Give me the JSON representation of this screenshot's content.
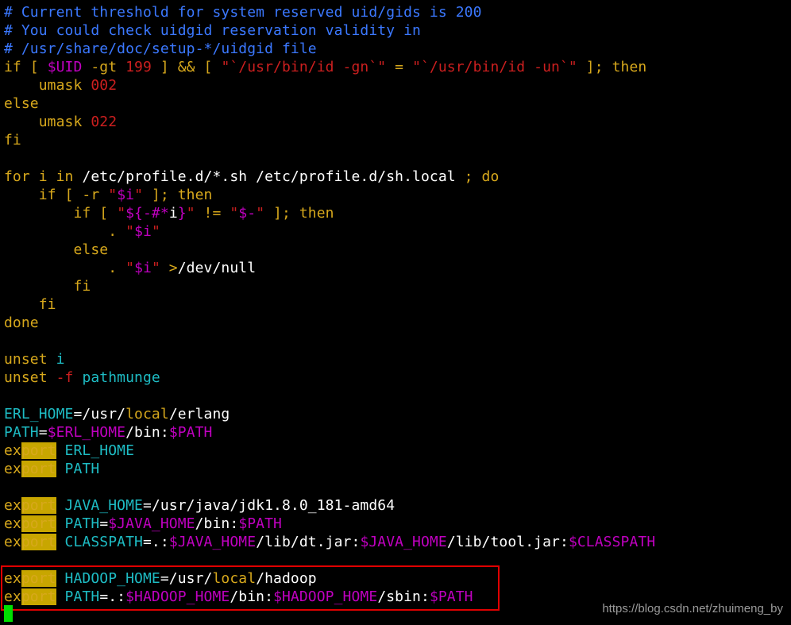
{
  "colors": {
    "comment": "#3b78ff",
    "keyword": "#d7a81c",
    "string": "#cc1f1f",
    "variable": "#c000c0",
    "identifier": "#1ebcc4",
    "plain": "#ffffff",
    "search_highlight": "#c8a600",
    "annotation_box": "#e00000",
    "cursor": "#00e000"
  },
  "lines": [
    [
      {
        "t": "# Current threshold for system reserved uid/gids is 200",
        "c": "comment"
      }
    ],
    [
      {
        "t": "# You could check uidgid reservation validity in",
        "c": "comment"
      }
    ],
    [
      {
        "t": "# /usr/share/doc/setup-*/uidgid file",
        "c": "comment"
      }
    ],
    [
      {
        "t": "if [ ",
        "c": "keyword"
      },
      {
        "t": "$UID",
        "c": "variable"
      },
      {
        "t": " -gt ",
        "c": "keyword"
      },
      {
        "t": "199",
        "c": "string"
      },
      {
        "t": " ] && [ ",
        "c": "keyword"
      },
      {
        "t": "\"`/usr/bin/id -gn`\"",
        "c": "string"
      },
      {
        "t": " = ",
        "c": "keyword"
      },
      {
        "t": "\"`/usr/bin/id -un`\"",
        "c": "string"
      },
      {
        "t": " ]; then",
        "c": "keyword"
      }
    ],
    [
      {
        "t": "    umask ",
        "c": "keyword"
      },
      {
        "t": "002",
        "c": "string"
      }
    ],
    [
      {
        "t": "else",
        "c": "keyword"
      }
    ],
    [
      {
        "t": "    umask ",
        "c": "keyword"
      },
      {
        "t": "022",
        "c": "string"
      }
    ],
    [
      {
        "t": "fi",
        "c": "keyword"
      }
    ],
    [],
    [
      {
        "t": "for i in ",
        "c": "keyword"
      },
      {
        "t": "/etc/profile.d/*.sh /etc/profile.d/sh.local ",
        "c": "plain"
      },
      {
        "t": "; do",
        "c": "keyword"
      }
    ],
    [
      {
        "t": "    if [ -r ",
        "c": "keyword"
      },
      {
        "t": "\"",
        "c": "string"
      },
      {
        "t": "$i",
        "c": "variable"
      },
      {
        "t": "\"",
        "c": "string"
      },
      {
        "t": " ]; then",
        "c": "keyword"
      }
    ],
    [
      {
        "t": "        if [ ",
        "c": "keyword"
      },
      {
        "t": "\"",
        "c": "string"
      },
      {
        "t": "${-#*",
        "c": "variable"
      },
      {
        "t": "i",
        "c": "plain"
      },
      {
        "t": "}",
        "c": "variable"
      },
      {
        "t": "\"",
        "c": "string"
      },
      {
        "t": " != ",
        "c": "keyword"
      },
      {
        "t": "\"",
        "c": "string"
      },
      {
        "t": "$-",
        "c": "variable"
      },
      {
        "t": "\"",
        "c": "string"
      },
      {
        "t": " ]; then",
        "c": "keyword"
      }
    ],
    [
      {
        "t": "            . ",
        "c": "keyword"
      },
      {
        "t": "\"",
        "c": "string"
      },
      {
        "t": "$i",
        "c": "variable"
      },
      {
        "t": "\"",
        "c": "string"
      }
    ],
    [
      {
        "t": "        else",
        "c": "keyword"
      }
    ],
    [
      {
        "t": "            . ",
        "c": "keyword"
      },
      {
        "t": "\"",
        "c": "string"
      },
      {
        "t": "$i",
        "c": "variable"
      },
      {
        "t": "\"",
        "c": "string"
      },
      {
        "t": " >",
        "c": "keyword"
      },
      {
        "t": "/dev/null",
        "c": "plain"
      }
    ],
    [
      {
        "t": "        fi",
        "c": "keyword"
      }
    ],
    [
      {
        "t": "    fi",
        "c": "keyword"
      }
    ],
    [
      {
        "t": "done",
        "c": "keyword"
      }
    ],
    [],
    [
      {
        "t": "unset ",
        "c": "keyword"
      },
      {
        "t": "i",
        "c": "identifier"
      }
    ],
    [
      {
        "t": "unset ",
        "c": "keyword"
      },
      {
        "t": "-f ",
        "c": "string"
      },
      {
        "t": "pathmunge",
        "c": "identifier"
      }
    ],
    [],
    [
      {
        "t": "ERL_HOME",
        "c": "identifier"
      },
      {
        "t": "=/usr/",
        "c": "plain"
      },
      {
        "t": "local",
        "c": "keyword"
      },
      {
        "t": "/erlang",
        "c": "plain"
      }
    ],
    [
      {
        "t": "PATH",
        "c": "identifier"
      },
      {
        "t": "=",
        "c": "plain"
      },
      {
        "t": "$ERL_HOME",
        "c": "variable"
      },
      {
        "t": "/bin:",
        "c": "plain"
      },
      {
        "t": "$PATH",
        "c": "variable"
      }
    ],
    [
      {
        "t": "ex",
        "c": "keyword"
      },
      {
        "t": "port",
        "c": "keyword",
        "hl": true
      },
      {
        "t": " ERL_HOME",
        "c": "identifier"
      }
    ],
    [
      {
        "t": "ex",
        "c": "keyword"
      },
      {
        "t": "port",
        "c": "keyword",
        "hl": true
      },
      {
        "t": " PATH",
        "c": "identifier"
      }
    ],
    [],
    [
      {
        "t": "ex",
        "c": "keyword"
      },
      {
        "t": "port",
        "c": "keyword",
        "hl": true
      },
      {
        "t": " JAVA_HOME",
        "c": "identifier"
      },
      {
        "t": "=/usr/java/jdk1.8.0_181-amd64",
        "c": "plain"
      }
    ],
    [
      {
        "t": "ex",
        "c": "keyword"
      },
      {
        "t": "port",
        "c": "keyword",
        "hl": true
      },
      {
        "t": " PATH",
        "c": "identifier"
      },
      {
        "t": "=",
        "c": "plain"
      },
      {
        "t": "$JAVA_HOME",
        "c": "variable"
      },
      {
        "t": "/bin:",
        "c": "plain"
      },
      {
        "t": "$PATH",
        "c": "variable"
      }
    ],
    [
      {
        "t": "ex",
        "c": "keyword"
      },
      {
        "t": "port",
        "c": "keyword",
        "hl": true
      },
      {
        "t": " CLASSPATH",
        "c": "identifier"
      },
      {
        "t": "=.:",
        "c": "plain"
      },
      {
        "t": "$JAVA_HOME",
        "c": "variable"
      },
      {
        "t": "/lib/dt.jar:",
        "c": "plain"
      },
      {
        "t": "$JAVA_HOME",
        "c": "variable"
      },
      {
        "t": "/lib/tool.jar:",
        "c": "plain"
      },
      {
        "t": "$CLASSPATH",
        "c": "variable"
      }
    ],
    [],
    [
      {
        "t": "ex",
        "c": "keyword"
      },
      {
        "t": "port",
        "c": "keyword",
        "hl": true
      },
      {
        "t": " HADOOP_HOME",
        "c": "identifier"
      },
      {
        "t": "=/usr/",
        "c": "plain"
      },
      {
        "t": "local",
        "c": "keyword"
      },
      {
        "t": "/hadoop",
        "c": "plain"
      }
    ],
    [
      {
        "t": "ex",
        "c": "keyword"
      },
      {
        "t": "port",
        "c": "keyword",
        "hl": true
      },
      {
        "t": " PATH",
        "c": "identifier"
      },
      {
        "t": "=.:",
        "c": "plain"
      },
      {
        "t": "$HADOOP_HOME",
        "c": "variable"
      },
      {
        "t": "/bin:",
        "c": "plain"
      },
      {
        "t": "$HADOOP_HOME",
        "c": "variable"
      },
      {
        "t": "/sbin:",
        "c": "plain"
      },
      {
        "t": "$PATH",
        "c": "variable"
      }
    ]
  ],
  "watermark": "https://blog.csdn.net/zhuimeng_by"
}
